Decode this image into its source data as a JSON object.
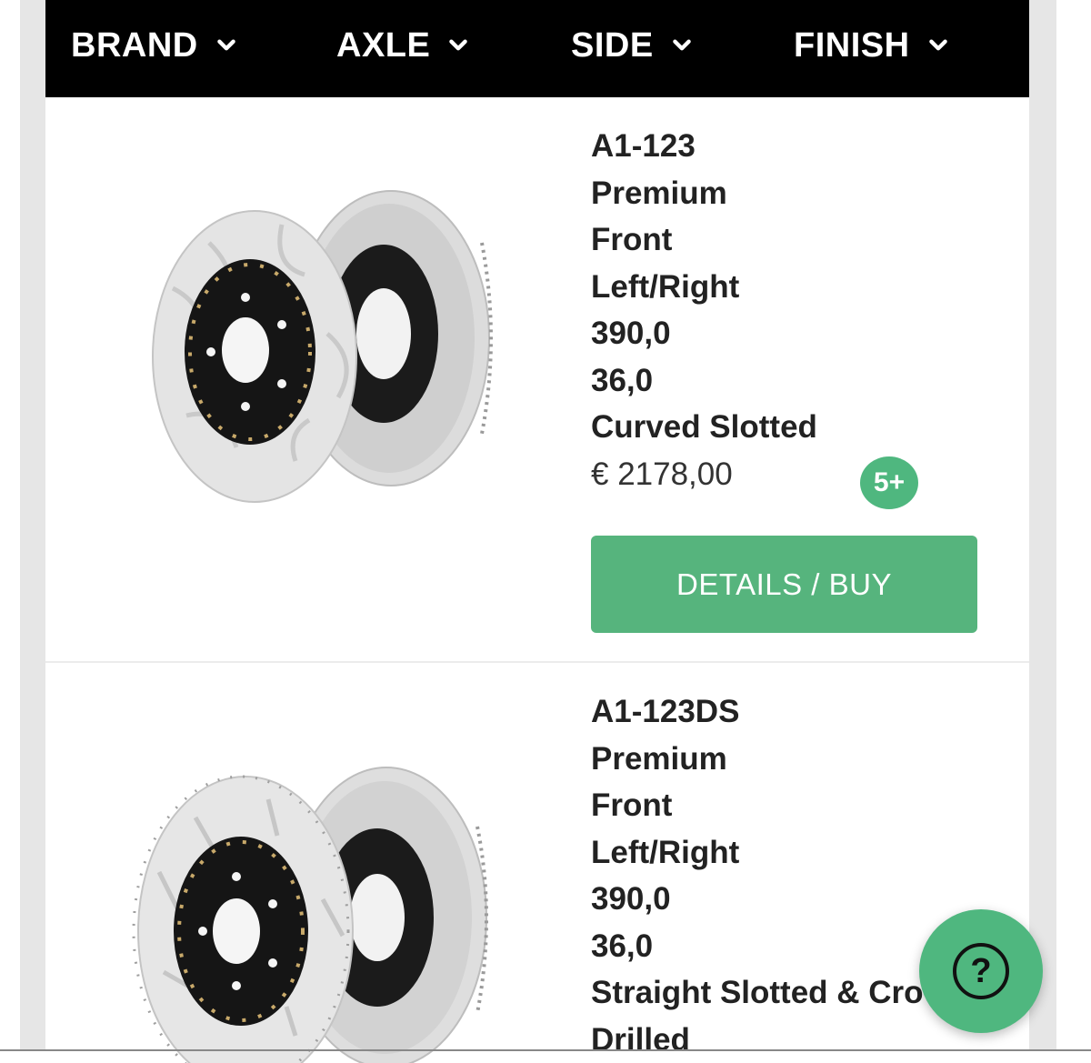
{
  "filters": [
    {
      "label": "BRAND"
    },
    {
      "label": "AXLE"
    },
    {
      "label": "SIDE"
    },
    {
      "label": "FINISH"
    }
  ],
  "products": [
    {
      "code": "A1-123",
      "grade": "Premium",
      "axle": "Front",
      "side": "Left/Right",
      "diameter": "390,0",
      "thickness": "36,0",
      "finish": "Curved Slotted",
      "price": "€ 2178,00",
      "stock_badge": "5+",
      "button_label": "DETAILS / BUY"
    },
    {
      "code": "A1-123DS",
      "grade": "Premium",
      "axle": "Front",
      "side": "Left/Right",
      "diameter": "390,0",
      "thickness": "36,0",
      "finish_line1": "Straight Slotted & Cro",
      "finish_line2": "Drilled"
    }
  ],
  "help": {
    "icon": "question-icon",
    "glyph": "?"
  },
  "colors": {
    "filter_bar": "#000000",
    "accent_green": "#56b47d",
    "text": "#222222"
  }
}
